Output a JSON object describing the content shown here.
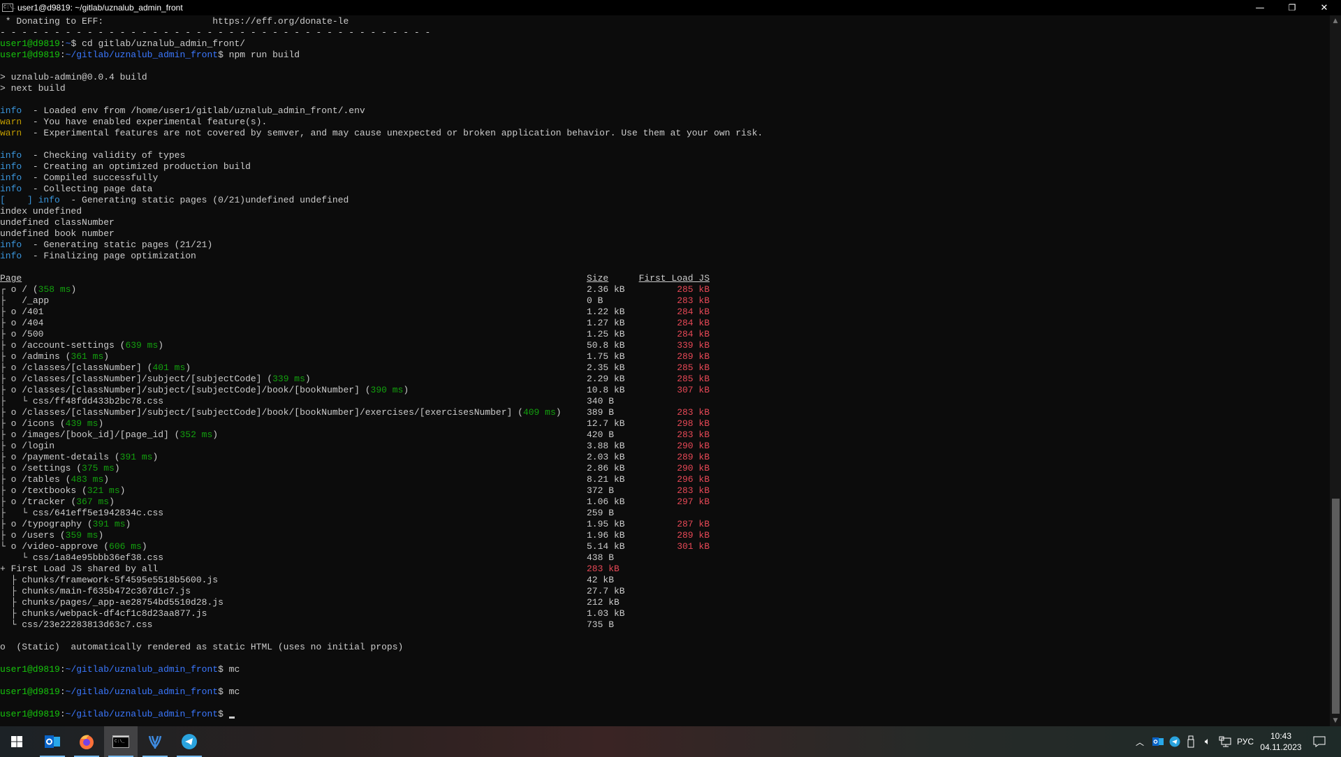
{
  "window": {
    "title": "user1@d9819: ~/gitlab/uznalub_admin_front",
    "icon": "console-icon",
    "icon_text": "C:\\_",
    "minimize": "—",
    "maximize": "❐",
    "close": "✕"
  },
  "colors": {
    "background": "#0c0c0c",
    "text": "#cccccc",
    "prompt_user": "#16c60c",
    "prompt_path": "#3b78ff",
    "info": "#3a96dd",
    "warn": "#c19c00",
    "duration": "#13a10e",
    "first_load": "#e74856"
  },
  "lines_before": [
    [
      [
        " * Donating to EFF:                    https://eff.org/donate-le",
        "w"
      ]
    ],
    [
      [
        "- - - - - - - - - - - - - - - - - - - - - - - - - - - - - - - - - - - - - - - -",
        "w"
      ]
    ],
    [
      [
        "user1@d9819",
        "g"
      ],
      [
        ":",
        "w"
      ],
      [
        "~",
        "b"
      ],
      [
        "$ cd gitlab/uznalub_admin_front/",
        "w"
      ]
    ],
    [
      [
        "user1@d9819",
        "g"
      ],
      [
        ":",
        "w"
      ],
      [
        "~/gitlab/uznalub_admin_front",
        "b"
      ],
      [
        "$ npm run build",
        "w"
      ]
    ],
    [],
    [
      [
        "> uznalub-admin@0.0.4 build",
        "w"
      ]
    ],
    [
      [
        "> next build",
        "w"
      ]
    ],
    [],
    [
      [
        "info",
        "i"
      ],
      [
        "  - Loaded env from /home/user1/gitlab/uznalub_admin_front/.env",
        "w"
      ]
    ],
    [
      [
        "warn",
        "y"
      ],
      [
        "  - You have enabled experimental feature(s).",
        "w"
      ]
    ],
    [
      [
        "warn",
        "y"
      ],
      [
        "  - Experimental features are not covered by semver, and may cause unexpected or broken application behavior. Use them at your own risk.",
        "w"
      ]
    ],
    [],
    [
      [
        "info",
        "i"
      ],
      [
        "  - Checking validity of types",
        "w"
      ]
    ],
    [
      [
        "info",
        "i"
      ],
      [
        "  - Creating an optimized production build",
        "w"
      ]
    ],
    [
      [
        "info",
        "i"
      ],
      [
        "  - Compiled successfully",
        "w"
      ]
    ],
    [
      [
        "info",
        "i"
      ],
      [
        "  - Collecting page data",
        "w"
      ]
    ],
    [
      [
        "[    ] ",
        "i"
      ],
      [
        "info",
        "i"
      ],
      [
        "  - Generating static pages (0/21)undefined undefined",
        "w"
      ]
    ],
    [
      [
        "index undefined",
        "w"
      ]
    ],
    [
      [
        "undefined classNumber",
        "w"
      ]
    ],
    [
      [
        "undefined book number",
        "w"
      ]
    ],
    [
      [
        "info",
        "i"
      ],
      [
        "  - Generating static pages (21/21)",
        "w"
      ]
    ],
    [
      [
        "info",
        "i"
      ],
      [
        "  - Finalizing page optimization",
        "w"
      ]
    ],
    []
  ],
  "table": {
    "headers": {
      "page": "Page",
      "size": "Size",
      "first_load": "First Load JS"
    },
    "rows": [
      {
        "prefix": "┌ o ",
        "name": "/",
        "ms": "358 ms",
        "size": "2.36 kB",
        "first": "285 kB"
      },
      {
        "prefix": "├   ",
        "name": "/_app",
        "ms": "",
        "size": "0 B",
        "first": "283 kB"
      },
      {
        "prefix": "├ o ",
        "name": "/401",
        "ms": "",
        "size": "1.22 kB",
        "first": "284 kB"
      },
      {
        "prefix": "├ o ",
        "name": "/404",
        "ms": "",
        "size": "1.27 kB",
        "first": "284 kB"
      },
      {
        "prefix": "├ o ",
        "name": "/500",
        "ms": "",
        "size": "1.25 kB",
        "first": "284 kB"
      },
      {
        "prefix": "├ o ",
        "name": "/account-settings",
        "ms": "639 ms",
        "size": "50.8 kB",
        "first": "339 kB"
      },
      {
        "prefix": "├ o ",
        "name": "/admins",
        "ms": "361 ms",
        "size": "1.75 kB",
        "first": "289 kB"
      },
      {
        "prefix": "├ o ",
        "name": "/classes/[classNumber]",
        "ms": "401 ms",
        "size": "2.35 kB",
        "first": "285 kB"
      },
      {
        "prefix": "├ o ",
        "name": "/classes/[classNumber]/subject/[subjectCode]",
        "ms": "339 ms",
        "size": "2.29 kB",
        "first": "285 kB"
      },
      {
        "prefix": "├ o ",
        "name": "/classes/[classNumber]/subject/[subjectCode]/book/[bookNumber]",
        "ms": "390 ms",
        "size": "10.8 kB",
        "first": "307 kB"
      },
      {
        "prefix": "├   └ ",
        "name": "css/ff48fdd433b2bc78.css",
        "ms": "",
        "size": "340 B",
        "first": ""
      },
      {
        "prefix": "├ o ",
        "name": "/classes/[classNumber]/subject/[subjectCode]/book/[bookNumber]/exercises/[exercisesNumber]",
        "ms": "409 ms",
        "size": "389 B",
        "first": "283 kB"
      },
      {
        "prefix": "├ o ",
        "name": "/icons",
        "ms": "439 ms",
        "size": "12.7 kB",
        "first": "298 kB"
      },
      {
        "prefix": "├ o ",
        "name": "/images/[book_id]/[page_id]",
        "ms": "352 ms",
        "size": "420 B",
        "first": "283 kB"
      },
      {
        "prefix": "├ o ",
        "name": "/login",
        "ms": "",
        "size": "3.88 kB",
        "first": "290 kB"
      },
      {
        "prefix": "├ o ",
        "name": "/payment-details",
        "ms": "391 ms",
        "size": "2.03 kB",
        "first": "289 kB"
      },
      {
        "prefix": "├ o ",
        "name": "/settings",
        "ms": "375 ms",
        "size": "2.86 kB",
        "first": "290 kB"
      },
      {
        "prefix": "├ o ",
        "name": "/tables",
        "ms": "483 ms",
        "size": "8.21 kB",
        "first": "296 kB"
      },
      {
        "prefix": "├ o ",
        "name": "/textbooks",
        "ms": "321 ms",
        "size": "372 B",
        "first": "283 kB"
      },
      {
        "prefix": "├ o ",
        "name": "/tracker",
        "ms": "367 ms",
        "size": "1.06 kB",
        "first": "297 kB"
      },
      {
        "prefix": "├   └ ",
        "name": "css/641eff5e1942834c.css",
        "ms": "",
        "size": "259 B",
        "first": ""
      },
      {
        "prefix": "├ o ",
        "name": "/typography",
        "ms": "391 ms",
        "size": "1.95 kB",
        "first": "287 kB"
      },
      {
        "prefix": "├ o ",
        "name": "/users",
        "ms": "359 ms",
        "size": "1.96 kB",
        "first": "289 kB"
      },
      {
        "prefix": "└ o ",
        "name": "/video-approve",
        "ms": "606 ms",
        "size": "5.14 kB",
        "first": "301 kB"
      },
      {
        "prefix": "    └ ",
        "name": "css/1a84e95bbb36ef38.css",
        "ms": "",
        "size": "438 B",
        "first": ""
      }
    ],
    "shared": {
      "label": "+ First Load JS shared by all",
      "value": "283 kB",
      "items": [
        {
          "prefix": "  ├ ",
          "name": "chunks/framework-5f4595e5518b5600.js",
          "size": "42 kB"
        },
        {
          "prefix": "  ├ ",
          "name": "chunks/main-f635b472c367d1c7.js",
          "size": "27.7 kB"
        },
        {
          "prefix": "  ├ ",
          "name": "chunks/pages/_app-ae28754bd5510d28.js",
          "size": "212 kB"
        },
        {
          "prefix": "  ├ ",
          "name": "chunks/webpack-df4cf1c8d23aa877.js",
          "size": "1.03 kB"
        },
        {
          "prefix": "  └ ",
          "name": "css/23e22283813d63c7.css",
          "size": "735 B"
        }
      ]
    }
  },
  "lines_after": [
    [],
    [
      [
        "o  (Static)  automatically rendered as static HTML (uses no initial props)",
        "w"
      ]
    ],
    [],
    [
      [
        "user1@d9819",
        "g"
      ],
      [
        ":",
        "w"
      ],
      [
        "~/gitlab/uznalub_admin_front",
        "b"
      ],
      [
        "$ mc",
        "w"
      ]
    ],
    [],
    [
      [
        "user1@d9819",
        "g"
      ],
      [
        ":",
        "w"
      ],
      [
        "~/gitlab/uznalub_admin_front",
        "b"
      ],
      [
        "$ mc",
        "w"
      ]
    ],
    [],
    [
      [
        "user1@d9819",
        "g"
      ],
      [
        ":",
        "w"
      ],
      [
        "~/gitlab/uznalub_admin_front",
        "b"
      ],
      [
        "$ ",
        "w"
      ]
    ]
  ],
  "taskbar": {
    "apps": [
      {
        "name": "start",
        "icon": "windows-icon",
        "active": false
      },
      {
        "name": "outlook",
        "icon": "outlook-icon",
        "active": false
      },
      {
        "name": "firefox",
        "icon": "firefox-icon",
        "active": false
      },
      {
        "name": "terminal",
        "icon": "terminal-icon",
        "active": true
      },
      {
        "name": "vscodium",
        "icon": "vscodium-icon",
        "active": false
      },
      {
        "name": "telegram",
        "icon": "telegram-icon",
        "active": false
      }
    ],
    "tray": {
      "language": "РУС",
      "time": "10:43",
      "date": "04.11.2023"
    }
  }
}
